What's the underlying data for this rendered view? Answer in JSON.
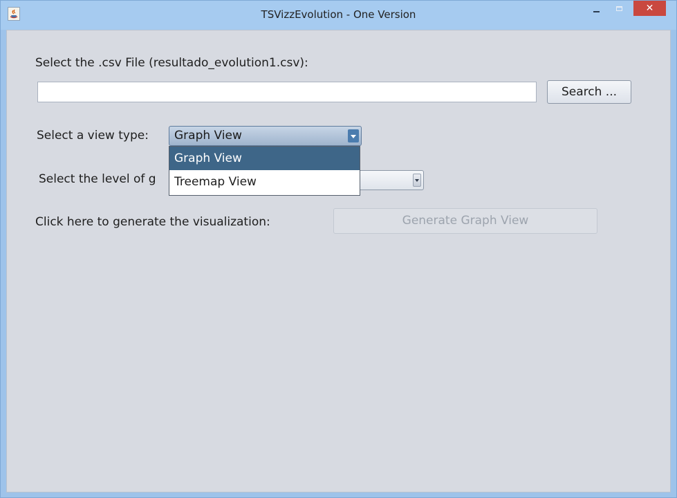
{
  "window": {
    "title": "TSVizzEvolution - One Version",
    "close_glyph": "✕",
    "icons": [
      "java-app-icon",
      "minimize-icon",
      "maximize-icon",
      "close-icon"
    ]
  },
  "form": {
    "file_label": "Select the .csv File (resultado_evolution1.csv):",
    "file_value": "",
    "search_button": "Search ...",
    "view_type_label": "Select a view type:",
    "view_type_selected": "Graph View",
    "view_type_options": [
      "Graph View",
      "Treemap View"
    ],
    "level_label": "Select the level of g",
    "level_selected": "",
    "generate_label": "Click here to generate the visualization:",
    "generate_button": "Generate Graph View",
    "generate_enabled": false
  },
  "colors": {
    "titlebar": "#a6cbf0",
    "client_bg": "#d7dae1",
    "selection": "#3e6688",
    "close_button": "#c9483f",
    "disabled_text": "#9da4ae"
  }
}
